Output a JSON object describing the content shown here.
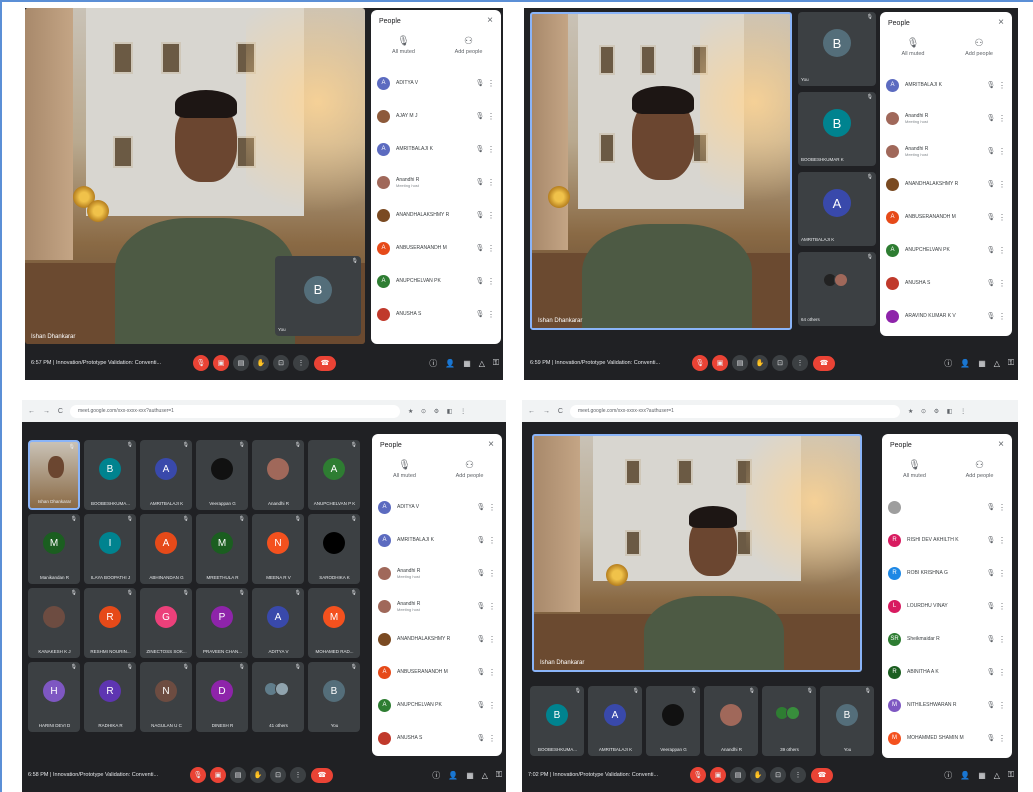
{
  "meeting": {
    "title": "Innovation/Prototype Validation: Conventi...",
    "title_short": "Innovation/Prototype Validation: Conventi...",
    "speaker_name": "Ishan Dhankarar"
  },
  "people_panel": {
    "title": "People",
    "close": "×",
    "all_muted": "All muted",
    "add_people": "Add people"
  },
  "browser": {
    "url": "meet.google.com/xxx-xxxx-xxx?authuser=1",
    "nav": "← → C",
    "extensions": "★ ⊙ ⚙ ◧ ⋮"
  },
  "shot1": {
    "time": "6:57 PM",
    "self_tile": {
      "initial": "B",
      "label": "You"
    },
    "participants": [
      {
        "initial": "A",
        "color": "#5c6bc0",
        "name": "ADITYA V"
      },
      {
        "initial": "",
        "color": "#8d5a3b",
        "name": "AJAY M J"
      },
      {
        "initial": "A",
        "color": "#5c6bc0",
        "name": "AMRITBALAJI K"
      },
      {
        "initial": "",
        "color": "#a0685a",
        "name": "Anandhi R",
        "sub": "Meeting host"
      },
      {
        "initial": "",
        "color": "#7a4a22",
        "name": "ANANDHALAKSHMY R"
      },
      {
        "initial": "A",
        "color": "#e64a19",
        "name": "ANBUSERANANDH M"
      },
      {
        "initial": "A",
        "color": "#2e7d32",
        "name": "ANUPCHELVAN PK"
      },
      {
        "initial": "",
        "color": "#c0392b",
        "name": "ANUSHA S"
      }
    ]
  },
  "shot2": {
    "time": "6:59 PM",
    "side_tiles": [
      {
        "initial": "B",
        "color": "#546e7a",
        "label": "You"
      },
      {
        "initial": "B",
        "color": "#00838f",
        "label": "BOOBESHKUMAR K"
      },
      {
        "initial": "A",
        "color": "#3949ab",
        "label": "AMRITBALAJI K"
      },
      {
        "initial": "",
        "color": "#111",
        "label": "64 others"
      }
    ],
    "participants": [
      {
        "initial": "A",
        "color": "#5c6bc0",
        "name": "AMRITBALAJI K"
      },
      {
        "initial": "",
        "color": "#a0685a",
        "name": "Anandhi R",
        "sub": "Meeting host"
      },
      {
        "initial": "",
        "color": "#a0685a",
        "name": "Anandhi R",
        "sub": "Meeting host"
      },
      {
        "initial": "",
        "color": "#7a4a22",
        "name": "ANANDHALAKSHMY R"
      },
      {
        "initial": "A",
        "color": "#e64a19",
        "name": "ANBUSERANANDH M"
      },
      {
        "initial": "A",
        "color": "#2e7d32",
        "name": "ANUPCHELVAN PK"
      },
      {
        "initial": "",
        "color": "#c0392b",
        "name": "ANUSHA S"
      },
      {
        "initial": "",
        "color": "#8e24aa",
        "name": "ARAVIND KUMAR K V"
      }
    ]
  },
  "shot3": {
    "time": "6:58 PM",
    "tiles": [
      {
        "initial": "",
        "color": "#8a6a45",
        "label": "Ishan Dhankarar",
        "video": true
      },
      {
        "initial": "B",
        "color": "#00838f",
        "label": "BOOBESHKUMA..."
      },
      {
        "initial": "A",
        "color": "#3949ab",
        "label": "AMRITBALAJI K"
      },
      {
        "initial": "",
        "color": "#111",
        "label": "Veerappan G"
      },
      {
        "initial": "",
        "color": "#a0685a",
        "label": "Anandhi R"
      },
      {
        "initial": "A",
        "color": "#2e7d32",
        "label": "ANUPCHELVAN P K"
      },
      {
        "initial": "M",
        "color": "#1b5e20",
        "label": "Manikandan R"
      },
      {
        "initial": "I",
        "color": "#00838f",
        "label": "ILAYA BOOPATHI J"
      },
      {
        "initial": "A",
        "color": "#e64a19",
        "label": "ABHINANDAN G"
      },
      {
        "initial": "M",
        "color": "#1b5e20",
        "label": "MREETHULA R"
      },
      {
        "initial": "N",
        "color": "#f4511e",
        "label": "MEENA R V"
      },
      {
        "initial": "",
        "color": "#000",
        "label": "SARODHIKA K"
      },
      {
        "initial": "",
        "color": "#6d4c41",
        "label": "KANAKESH K J"
      },
      {
        "initial": "R",
        "color": "#e64a19",
        "label": "RESHMI NOURIN..."
      },
      {
        "initial": "G",
        "color": "#ec407a",
        "label": "ZINECTOSS SOK..."
      },
      {
        "initial": "P",
        "color": "#8e24aa",
        "label": "PRAVEEN CHAN..."
      },
      {
        "initial": "A",
        "color": "#3949ab",
        "label": "ADITYA V"
      },
      {
        "initial": "M",
        "color": "#f4511e",
        "label": "MOHAMED RAD..."
      },
      {
        "initial": "H",
        "color": "#7e57c2",
        "label": "HARINI DEVI D"
      },
      {
        "initial": "R",
        "color": "#5e35b1",
        "label": "RADHIKA R"
      },
      {
        "initial": "N",
        "color": "#6d4c41",
        "label": "NAGULAN U C"
      },
      {
        "initial": "D",
        "color": "#8e24aa",
        "label": "DINESH R"
      },
      {
        "initial": "",
        "color": "#607d8b",
        "label": "41 others"
      },
      {
        "initial": "B",
        "color": "#546e7a",
        "label": "You"
      }
    ],
    "participants": [
      {
        "initial": "A",
        "color": "#5c6bc0",
        "name": "ADITYA V"
      },
      {
        "initial": "A",
        "color": "#5c6bc0",
        "name": "AMRITBALAJI K"
      },
      {
        "initial": "",
        "color": "#a0685a",
        "name": "Anandhi R",
        "sub": "Meeting host"
      },
      {
        "initial": "",
        "color": "#a0685a",
        "name": "Anandhi R",
        "sub": "Meeting host"
      },
      {
        "initial": "",
        "color": "#7a4a22",
        "name": "ANANDHALAKSHMY R"
      },
      {
        "initial": "A",
        "color": "#e64a19",
        "name": "ANBUSERANANDH M"
      },
      {
        "initial": "A",
        "color": "#2e7d32",
        "name": "ANUPCHELVAN PK"
      },
      {
        "initial": "",
        "color": "#c0392b",
        "name": "ANUSHA S"
      }
    ]
  },
  "shot4": {
    "time": "7:02 PM",
    "tiles": [
      {
        "initial": "B",
        "color": "#00838f",
        "label": "BOOBESHKUMA..."
      },
      {
        "initial": "A",
        "color": "#3949ab",
        "label": "AMRITBALAJI K"
      },
      {
        "initial": "",
        "color": "#111",
        "label": "Veerappan G"
      },
      {
        "initial": "",
        "color": "#a0685a",
        "label": "Anandhi R"
      },
      {
        "initial": "",
        "color": "#2e7d32",
        "label": "39 others"
      },
      {
        "initial": "B",
        "color": "#546e7a",
        "label": "You"
      }
    ],
    "participants": [
      {
        "initial": "",
        "color": "#9e9e9e",
        "name": ""
      },
      {
        "initial": "R",
        "color": "#d81b60",
        "name": "RISHI DEV AKHILTH K"
      },
      {
        "initial": "R",
        "color": "#1e88e5",
        "name": "ROBI KRISHNA G"
      },
      {
        "initial": "L",
        "color": "#d81b60",
        "name": "LOURDHU VINAY"
      },
      {
        "initial": "SR",
        "color": "#2e7d32",
        "name": "Sheikmaidar R"
      },
      {
        "initial": "R",
        "color": "#1b5e20",
        "name": "ABINITHA A K"
      },
      {
        "initial": "M",
        "color": "#7e57c2",
        "name": "NITHILESHWARAN R"
      },
      {
        "initial": "M",
        "color": "#f4511e",
        "name": "MOHAMMED SHAMIN M"
      }
    ]
  },
  "controls": {
    "mic": "🎙",
    "cam": "▣",
    "cc": "▤",
    "hand": "✋",
    "present": "⊡",
    "more": "⋮",
    "hang": "☎",
    "info": "ⓘ",
    "people": "👤",
    "chat": "▦",
    "activities": "△",
    "lock": "⚿"
  }
}
